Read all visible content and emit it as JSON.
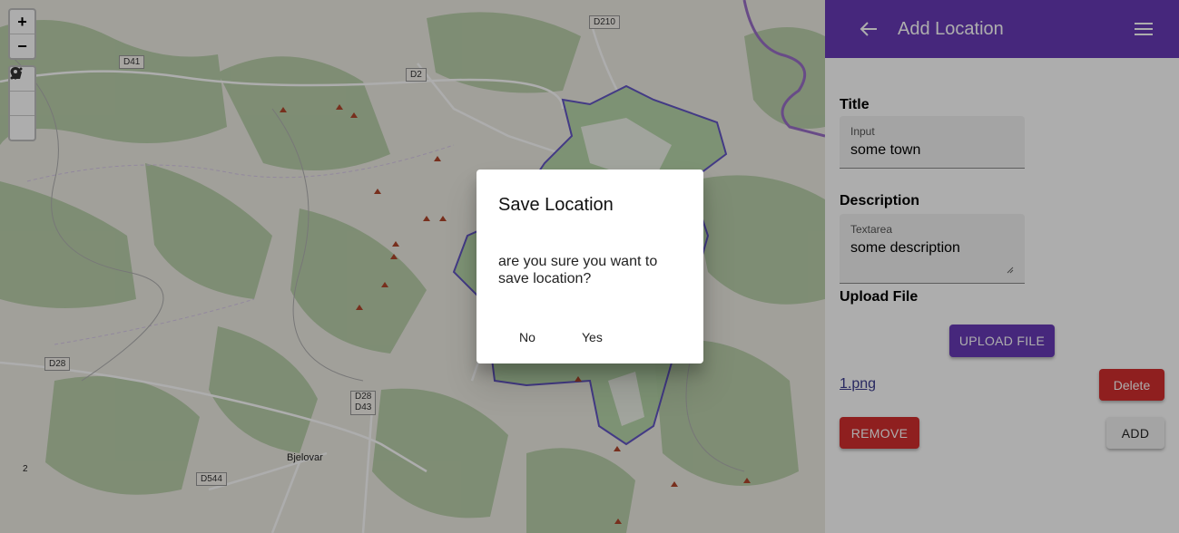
{
  "map": {
    "road_labels": [
      "D210",
      "D41",
      "D2",
      "D28",
      "D28",
      "D43",
      "D544"
    ],
    "place_labels": [
      "Bjelovar",
      "2"
    ],
    "zoom_in": "+",
    "zoom_out": "−"
  },
  "panel": {
    "title": "Add Location",
    "title_section": "Title",
    "title_field_label": "Input",
    "title_field_value": "some town",
    "description_section": "Description",
    "description_field_label": "Textarea",
    "description_field_value": "some description",
    "upload_section": "Upload File",
    "upload_button": "UPLOAD FILE",
    "file_name": "1.png",
    "delete_button": "Delete",
    "remove_button": "REMOVE",
    "add_button": "ADD"
  },
  "dialog": {
    "title": "Save Location",
    "message": "are you sure you want to save location?",
    "no_button": "No",
    "yes_button": "Yes"
  },
  "colors": {
    "primary": "#673ab7",
    "danger": "#d32f2f",
    "polygon_stroke": "#5c4fc4",
    "polygon_fill": "#b6d7a8"
  }
}
